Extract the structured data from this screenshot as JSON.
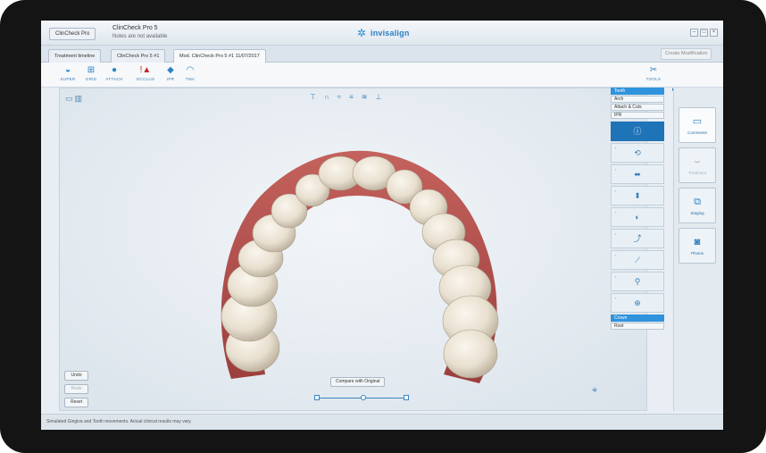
{
  "titlebar": {
    "app_button": "ClinCheck Pro",
    "title": "ClinCheck Pro 5",
    "subtitle": "Notes are not available",
    "brand": "invisalign"
  },
  "tabs": [
    {
      "label": "Treatment timeline"
    },
    {
      "label": "ClinCheck Pro 5 #1"
    },
    {
      "label": "Mod. ClinCheck Pro 5 #1 11/07/2017"
    }
  ],
  "create_modification_label": "Create Modification",
  "toolbar": {
    "items": [
      {
        "label": "SUPER",
        "icon": "super-icon"
      },
      {
        "label": "GRID",
        "icon": "grid-icon"
      },
      {
        "label": "ATTACH",
        "icon": "attach-icon"
      },
      {
        "label": "OCCLUS",
        "icon": "occlusion-icon"
      },
      {
        "label": "IPR",
        "icon": "ipr-icon"
      },
      {
        "label": "TMA",
        "icon": "tma-icon"
      }
    ],
    "tools_label": "TOOLS"
  },
  "viewport": {
    "undo_label": "Undo",
    "redo_label": "Redo",
    "reset_label": "Reset",
    "compare_label": "Compare with Original"
  },
  "tools_panel": {
    "modes": [
      "Tooth",
      "Arch",
      "Attach & Cuts",
      "IPR"
    ],
    "selected_mode": "Tooth",
    "bottom_options": [
      "Crown",
      "Root"
    ],
    "selected_bottom": "Crown"
  },
  "side_tabs": [
    {
      "label": "Comments",
      "icon": "comment-icon"
    },
    {
      "label": "Treatment",
      "icon": "treatment-icon"
    },
    {
      "label": "Staging",
      "icon": "staging-icon"
    },
    {
      "label": "Photos",
      "icon": "camera-icon"
    }
  ],
  "status_text": "Simulated Gingiva and Tooth movements. Actual clinical results may vary.",
  "colors": {
    "accent": "#2f93dd",
    "gum": "#b5504c",
    "tooth": "#ece3d3"
  }
}
